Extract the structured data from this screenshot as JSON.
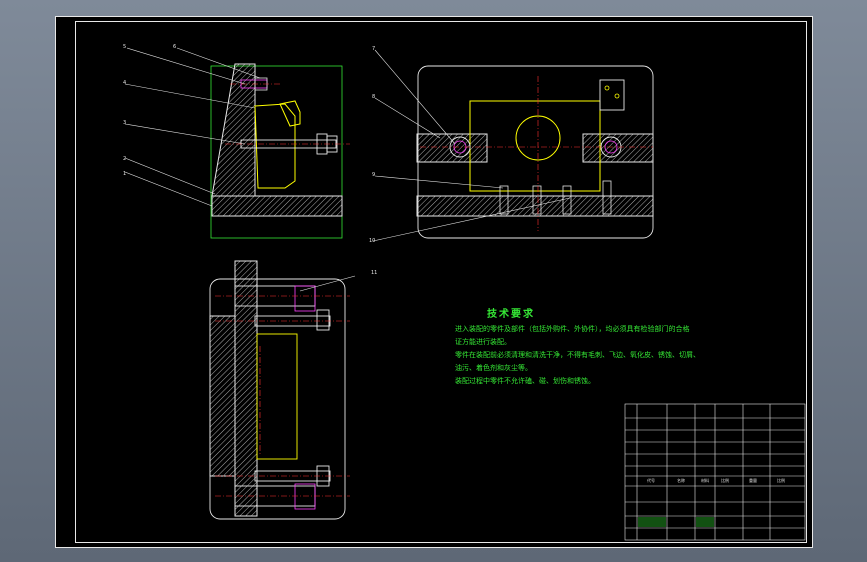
{
  "tech_requirements": {
    "title": "技术要求",
    "lines": [
      "进入装配的零件及部件（包括外购件、外协件），均必须具有检验部门的合格",
      "证方能进行装配。",
      "零件在装配前必须清理和清洗干净，不得有毛刺、飞边、氧化皮、锈蚀、切屑、",
      "油污、着色剂和灰尘等。",
      "装配过程中零件不允许磕、碰、划伤和锈蚀。"
    ]
  },
  "callouts": [
    "1",
    "2",
    "3",
    "4",
    "5",
    "6",
    "7",
    "8",
    "9",
    "10",
    "11"
  ],
  "title_block": {
    "bottom_labels": [
      "代号",
      "名称",
      "材料",
      "比例",
      "重量",
      "比例"
    ]
  },
  "colors": {
    "outline": "#e8e8e8",
    "hatch": "#e8e8e8",
    "center": "#ff3030",
    "part": "#ffff00",
    "dimension": "#35e835",
    "leader": "#e8e8e8",
    "magenta": "#ff40ff",
    "cyan": "#40e0ff"
  }
}
